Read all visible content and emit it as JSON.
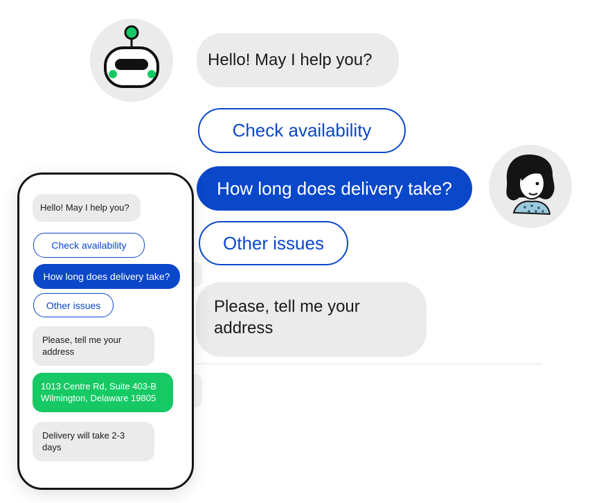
{
  "colors": {
    "accent_blue": "#0a47c9",
    "bubble_gray": "#ebebeb",
    "address_green": "#17c964"
  },
  "bot": {
    "avatar_icon": "robot-avatar-icon",
    "greeting": "Hello! May I help you?",
    "ask_address": "Please, tell me your address",
    "delivery_answer": "Delivery will take 2-3 days"
  },
  "user": {
    "avatar_icon": "user-avatar-icon",
    "address": "1013 Centre Rd, Suite 403-B Wilmington, Delaware 19805"
  },
  "quick_replies": {
    "check_availability": "Check availability",
    "delivery_time": "How long does delivery take?",
    "other_issues": "Other issues"
  }
}
